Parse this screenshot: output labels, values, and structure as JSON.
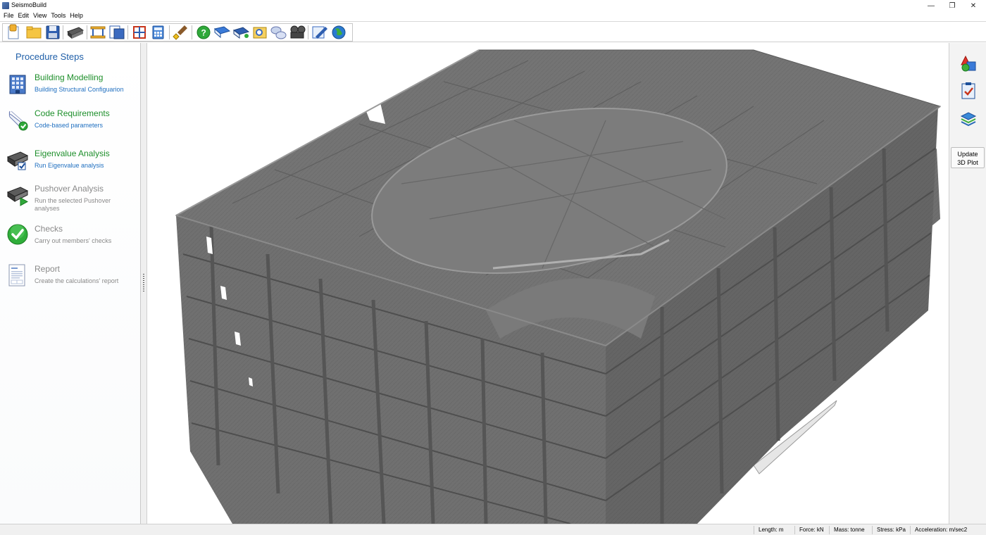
{
  "window": {
    "title": "SeismoBuild",
    "controls": {
      "minimize": "—",
      "restore": "❐",
      "close": "✕"
    }
  },
  "menu": [
    "File",
    "Edit",
    "View",
    "Tools",
    "Help"
  ],
  "toolbar": {
    "icons": [
      "new-project-icon",
      "open-folder-icon",
      "save-icon",
      "machine-icon",
      "beam-icon",
      "print-preview-icon",
      "structure-icon",
      "calculator-icon",
      "paint-brush-icon",
      "help-icon",
      "manual-book-icon",
      "tutorial-book-icon",
      "search-file-icon",
      "chat-icon",
      "film-icon",
      "edit-pencil-icon",
      "globe-icon"
    ]
  },
  "procedure": {
    "heading": "Procedure Steps",
    "steps": [
      {
        "title": "Building Modelling",
        "subtitle": "Building Structural Configuarion",
        "icon": "building-icon",
        "state": "active"
      },
      {
        "title": "Code Requirements",
        "subtitle": "Code-based parameters",
        "icon": "scroll-check-icon",
        "state": "active"
      },
      {
        "title": "Eigenvalue Analysis",
        "subtitle": "Run Eigenvalue analysis",
        "icon": "machine-check-icon",
        "state": "active"
      },
      {
        "title": "Pushover Analysis",
        "subtitle": "Run the selected Pushover analyses",
        "icon": "machine-play-icon",
        "state": "inactive"
      },
      {
        "title": "Checks",
        "subtitle": "Carry out members' checks",
        "icon": "green-check-icon",
        "state": "inactive"
      },
      {
        "title": "Report",
        "subtitle": "Create the calculations' report",
        "icon": "report-icon",
        "state": "inactive"
      }
    ]
  },
  "right_panel": {
    "icons": [
      "shapes-icon",
      "checklist-icon",
      "layers-icon"
    ],
    "update_button": [
      "Update",
      "3D Plot"
    ]
  },
  "status": {
    "length": "Length: m",
    "force": "Force: kN",
    "mass": "Mass: tonne",
    "stress": "Stress: kPa",
    "acceleration": "Acceleration: m/sec2"
  },
  "colors": {
    "accent_blue": "#1f5fa8",
    "active_green": "#1e8f2b",
    "inactive_gray": "#8a8a8a",
    "concrete": "#6f6f6f"
  }
}
